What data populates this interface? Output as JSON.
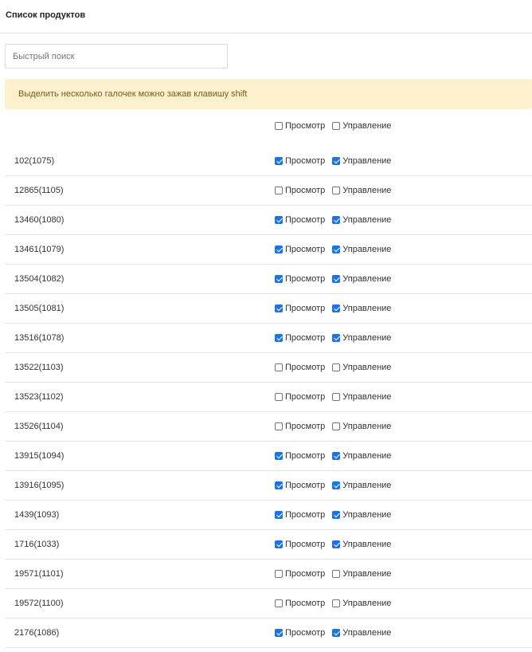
{
  "header": {
    "title": "Список продуктов"
  },
  "search": {
    "placeholder": "Быстрый поиск",
    "value": ""
  },
  "alert": {
    "text": "Выделить несколько галочек можно зажав клавишу shift"
  },
  "labels": {
    "view": "Просмотр",
    "manage": "Управление"
  },
  "master": {
    "view": false,
    "manage": false
  },
  "products": [
    {
      "name": "102(1075)",
      "view": true,
      "manage": true
    },
    {
      "name": "12865(1105)",
      "view": false,
      "manage": false
    },
    {
      "name": "13460(1080)",
      "view": true,
      "manage": true
    },
    {
      "name": "13461(1079)",
      "view": true,
      "manage": true
    },
    {
      "name": "13504(1082)",
      "view": true,
      "manage": true
    },
    {
      "name": "13505(1081)",
      "view": true,
      "manage": true
    },
    {
      "name": "13516(1078)",
      "view": true,
      "manage": true
    },
    {
      "name": "13522(1103)",
      "view": false,
      "manage": false
    },
    {
      "name": "13523(1102)",
      "view": false,
      "manage": false
    },
    {
      "name": "13526(1104)",
      "view": false,
      "manage": false
    },
    {
      "name": "13915(1094)",
      "view": true,
      "manage": true
    },
    {
      "name": "13916(1095)",
      "view": true,
      "manage": true
    },
    {
      "name": "1439(1093)",
      "view": true,
      "manage": true
    },
    {
      "name": "1716(1033)",
      "view": true,
      "manage": true
    },
    {
      "name": "19571(1101)",
      "view": false,
      "manage": false
    },
    {
      "name": "19572(1100)",
      "view": false,
      "manage": false
    },
    {
      "name": "2176(1086)",
      "view": true,
      "manage": true
    }
  ],
  "colors": {
    "checked": "#1a73e8",
    "alert_bg": "#fcf0cd",
    "alert_text": "#7a5a1a"
  }
}
